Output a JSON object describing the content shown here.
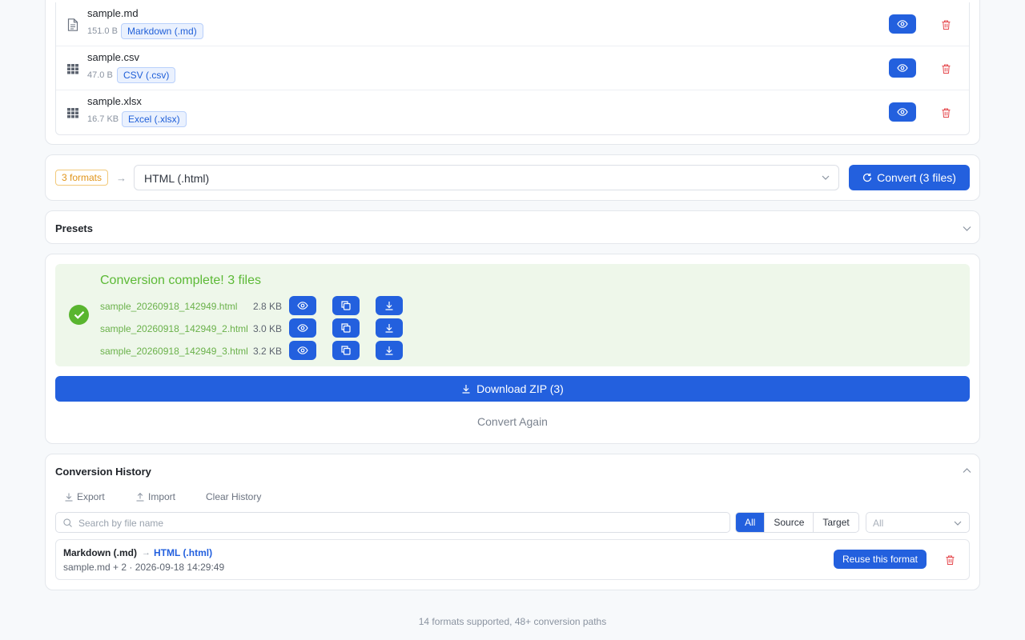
{
  "files": [
    {
      "name": "sample.md",
      "size": "151.0 B",
      "format": "Markdown (.md)",
      "icon": "file-text-icon"
    },
    {
      "name": "sample.csv",
      "size": "47.0 B",
      "format": "CSV (.csv)",
      "icon": "grid-icon"
    },
    {
      "name": "sample.xlsx",
      "size": "16.7 KB",
      "format": "Excel (.xlsx)",
      "icon": "grid-icon"
    }
  ],
  "convert": {
    "formats_count": "3 formats",
    "target": "HTML (.html)",
    "button": "Convert (3 files)"
  },
  "presets": {
    "title": "Presets"
  },
  "result": {
    "title": "Conversion complete! 3 files",
    "outputs": [
      {
        "name": "sample_20260918_142949.html",
        "size": "2.8 KB"
      },
      {
        "name": "sample_20260918_142949_2.html",
        "size": "3.0 KB"
      },
      {
        "name": "sample_20260918_142949_3.html",
        "size": "3.2 KB"
      }
    ],
    "zip_button": "Download ZIP (3)",
    "again": "Convert Again"
  },
  "history": {
    "title": "Conversion History",
    "export": "Export",
    "import": "Import",
    "clear": "Clear History",
    "search_placeholder": "Search by file name",
    "segments": [
      "All",
      "Source",
      "Target"
    ],
    "filter": "All",
    "items": [
      {
        "from": "Markdown (.md)",
        "to": "HTML (.html)",
        "meta": "sample.md + 2 · 2026-09-18 14:29:49",
        "reuse": "Reuse this format"
      }
    ]
  },
  "footer": "14 formats supported, 48+ conversion paths",
  "colors": {
    "accent": "#2360de",
    "success": "#59b52f",
    "danger": "#e5484d",
    "warning": "#e1951b"
  }
}
